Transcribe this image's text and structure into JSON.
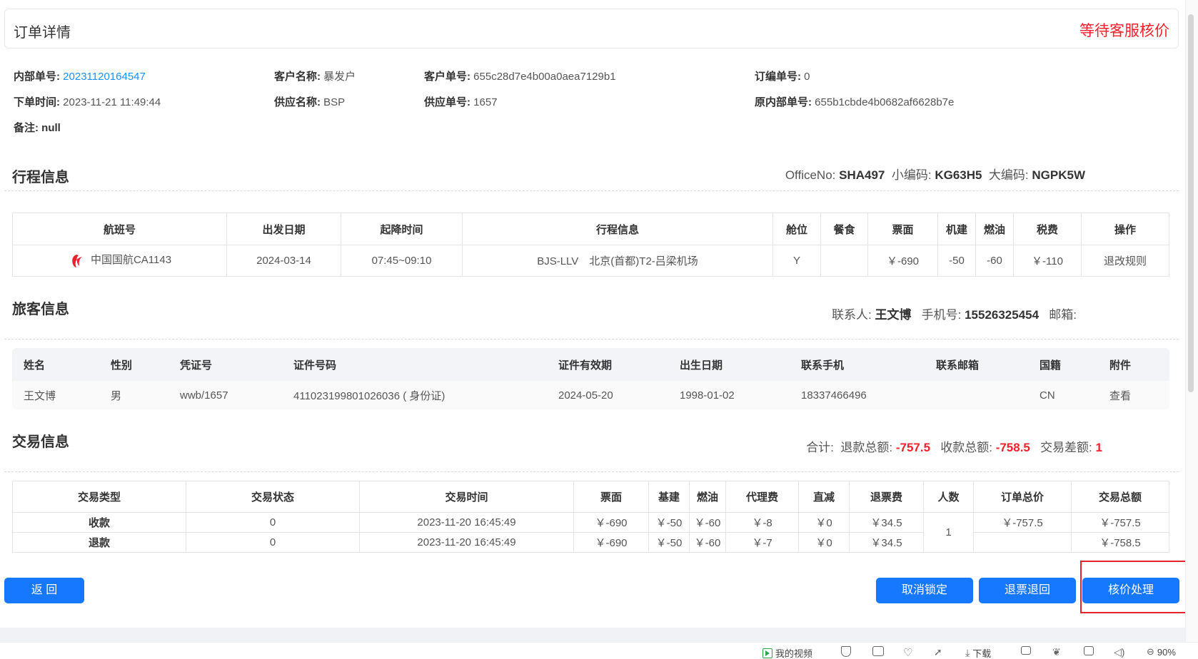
{
  "header": {
    "title": "订单详情",
    "status": "等待客服核价"
  },
  "order": {
    "internal_no_label": "内部单号:",
    "internal_no": "20231120164547",
    "customer_name_label": "客户名称:",
    "customer_name": "暴发户",
    "customer_no_label": "客户单号:",
    "customer_no": "655c28d7e4b00a0aea7129b1",
    "order_no_label": "订编单号:",
    "order_no": "0",
    "order_time_label": "下单时间:",
    "order_time": "2023-11-21 11:49:44",
    "supplier_name_label": "供应名称:",
    "supplier_name": "BSP",
    "supplier_no_label": "供应单号:",
    "supplier_no": "1657",
    "orig_internal_no_label": "原内部单号:",
    "orig_internal_no": "655b1cbde4b0682af6628b7e",
    "remark_label": "备注:",
    "remark": "null"
  },
  "itinerary": {
    "title": "行程信息",
    "office_label": "OfficeNo:",
    "office": "SHA497",
    "small_code_label": "小编码:",
    "small_code": "KG63H5",
    "big_code_label": "大编码:",
    "big_code": "NGPK5W",
    "columns": [
      "航班号",
      "出发日期",
      "起降时间",
      "行程信息",
      "舱位",
      "餐食",
      "票面",
      "机建",
      "燃油",
      "税费",
      "操作"
    ],
    "row": {
      "flight": "中国国航CA1143",
      "date": "2024-03-14",
      "time": "07:45~09:10",
      "route": "BJS-LLV　北京(首都)T2-吕梁机场",
      "cabin": "Y",
      "meal": "",
      "fare": "￥-690",
      "airport_fee": "-50",
      "fuel": "-60",
      "tax": "￥-110",
      "action": "退改规则"
    }
  },
  "passenger": {
    "title": "旅客信息",
    "contact_label": "联系人:",
    "contact": "王文博",
    "phone_label": "手机号:",
    "phone": "15526325454",
    "email_label": "邮箱:",
    "columns": [
      "姓名",
      "性别",
      "凭证号",
      "证件号码",
      "证件有效期",
      "出生日期",
      "联系手机",
      "联系邮箱",
      "国籍",
      "附件"
    ],
    "row": {
      "name": "王文博",
      "gender": "男",
      "voucher": "wwb/1657",
      "id_no": "411023199801026036 ( 身份证)",
      "expiry": "2024-05-20",
      "birth": "1998-01-02",
      "mobile": "18337466496",
      "email": "",
      "nationality": "CN",
      "attachment": "查看"
    }
  },
  "transaction": {
    "title": "交易信息",
    "total_label": "合计:",
    "refund_total_label": "退款总额:",
    "refund_total": "-757.5",
    "receive_total_label": "收款总额:",
    "receive_total": "-758.5",
    "diff_label": "交易差额:",
    "diff": "1",
    "columns": [
      "交易类型",
      "交易状态",
      "交易时间",
      "票面",
      "基建",
      "燃油",
      "代理费",
      "直减",
      "退票费",
      "人数",
      "订单总价",
      "交易总额"
    ],
    "rows": [
      {
        "type": "收款",
        "status": "0",
        "time": "2023-11-20 16:45:49",
        "fare": "￥-690",
        "base": "￥-50",
        "fuel": "￥-60",
        "agent": "￥-8",
        "direct": "￥0",
        "refund_fee": "￥34.5",
        "order_total": "￥-757.5",
        "amount": "￥-757.5"
      },
      {
        "type": "退款",
        "status": "0",
        "time": "2023-11-20 16:45:49",
        "fare": "￥-690",
        "base": "￥-50",
        "fuel": "￥-60",
        "agent": "￥-7",
        "direct": "￥0",
        "refund_fee": "￥34.5",
        "order_total": "",
        "amount": "￥-758.5"
      }
    ],
    "people": "1"
  },
  "buttons": {
    "back": "返 回",
    "cancel_lock": "取消锁定",
    "refund_return": "退票退回",
    "verify": "核价处理"
  },
  "statusbar": {
    "video": "我的视频",
    "download": "下载",
    "zoom": "90%"
  }
}
